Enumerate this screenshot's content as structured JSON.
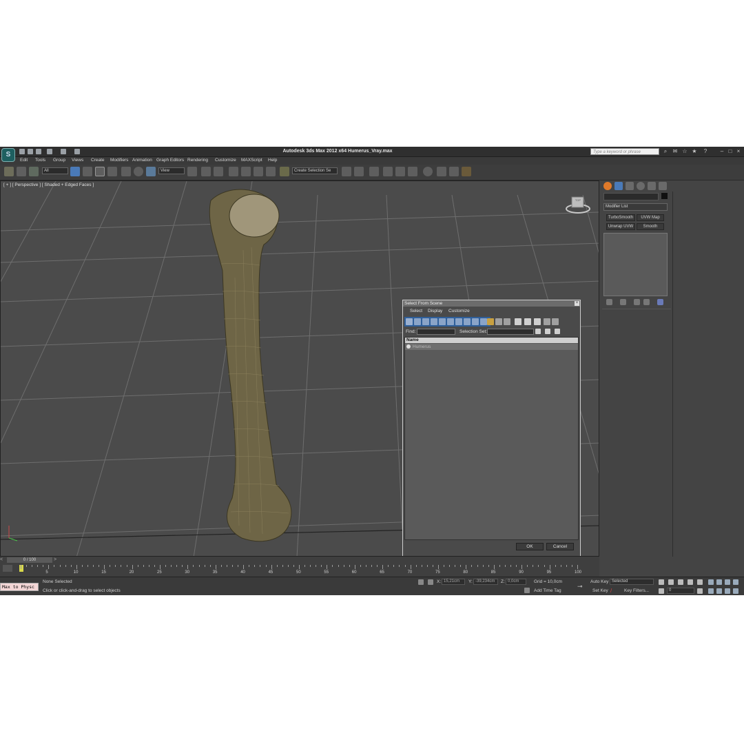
{
  "window": {
    "title": "Autodesk 3ds Max  2012 x64     Humerus_Vray.max",
    "search_placeholder": "Type a keyword or phrase"
  },
  "menu": [
    "Edit",
    "Tools",
    "Group",
    "Views",
    "Create",
    "Modifiers",
    "Animation",
    "Graph Editors",
    "Rendering",
    "Customize",
    "MAXScript",
    "Help"
  ],
  "toolbar": {
    "selection_filter": "All",
    "reference_coord": "View",
    "named_selection": "Create Selection Se"
  },
  "viewport": {
    "label": "[ + ] [ Perspective ] [ Shaded + Edged Faces ]",
    "viewcube_label": "TOP"
  },
  "dialog": {
    "title": "Select From Scene",
    "menu": [
      "Select",
      "Display",
      "Customize"
    ],
    "find_label": "Find:",
    "selection_set_label": "Selection Set:",
    "column_header": "Name",
    "items": [
      "Humerus"
    ],
    "ok": "OK",
    "cancel": "Cancel"
  },
  "command_panel": {
    "modifier_list": "Modifier List",
    "buttons": [
      "TurboSmooth",
      "UVW Map",
      "Unwrap UVW",
      "Smooth"
    ]
  },
  "timeline": {
    "frame": "0 / 100",
    "ticks": [
      "0",
      "5",
      "10",
      "15",
      "20",
      "25",
      "30",
      "35",
      "40",
      "45",
      "50",
      "55",
      "60",
      "65",
      "70",
      "75",
      "80",
      "85",
      "90",
      "95",
      "100"
    ]
  },
  "status": {
    "script_listener": "Max to Physc",
    "selection": "None Selected",
    "prompt": "Click or click-and-drag to select objects",
    "x_label": "X:",
    "x_value": "15,21cm",
    "y_label": "Y:",
    "y_value": "-39,234cm",
    "z_label": "Z:",
    "z_value": "0,0cm",
    "grid": "Grid = 10,0cm",
    "add_time_tag": "Add Time Tag",
    "auto_key": "Auto Key",
    "auto_key_mode": "Selected",
    "set_key": "Set Key",
    "key_filters": "Key Filters...",
    "current_frame": "0"
  }
}
